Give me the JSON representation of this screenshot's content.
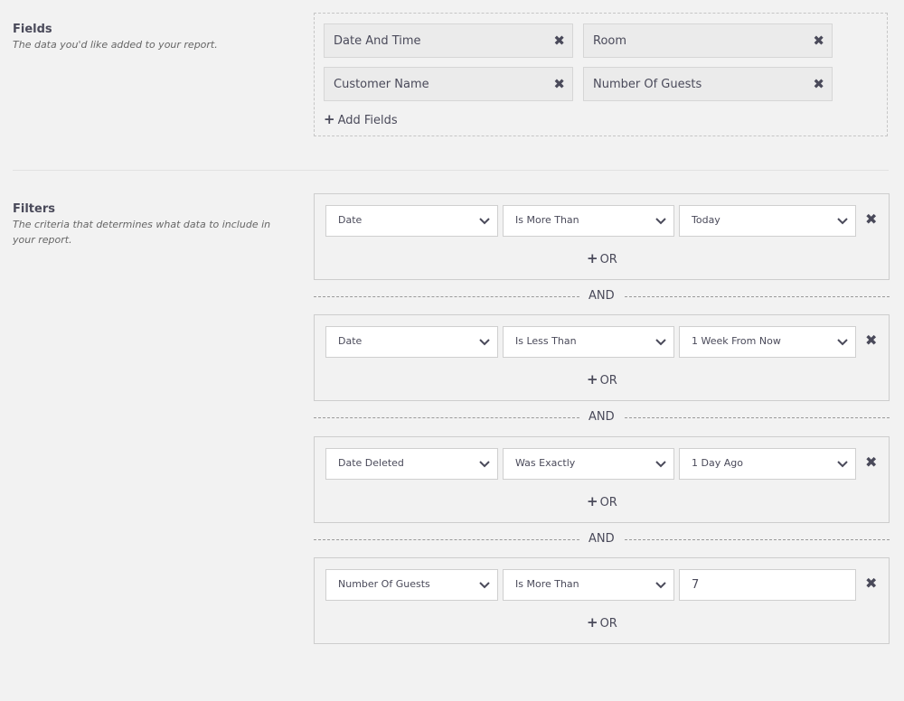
{
  "fields": {
    "title": "Fields",
    "description": "The data you'd like added to your report.",
    "chips": [
      {
        "label": "Date And Time"
      },
      {
        "label": "Room"
      },
      {
        "label": "Customer Name"
      },
      {
        "label": "Number Of Guests"
      }
    ],
    "remove_icon": "✖",
    "add_label": "Add Fields",
    "add_icon": "+"
  },
  "filters": {
    "title": "Filters",
    "description": "The criteria that determines what data to include in your report.",
    "or_label": "OR",
    "or_icon": "+",
    "and_label": "AND",
    "remove_icon": "✖",
    "rows": [
      {
        "field": "Date",
        "operator": "Is More Than",
        "value": "Today",
        "value_is_select": true
      },
      {
        "field": "Date",
        "operator": "Is Less Than",
        "value": "1 Week From Now",
        "value_is_select": true
      },
      {
        "field": "Date Deleted",
        "operator": "Was Exactly",
        "value": "1 Day Ago",
        "value_is_select": true
      },
      {
        "field": "Number Of Guests",
        "operator": "Is More Than",
        "value": "7",
        "value_is_select": false
      }
    ]
  }
}
